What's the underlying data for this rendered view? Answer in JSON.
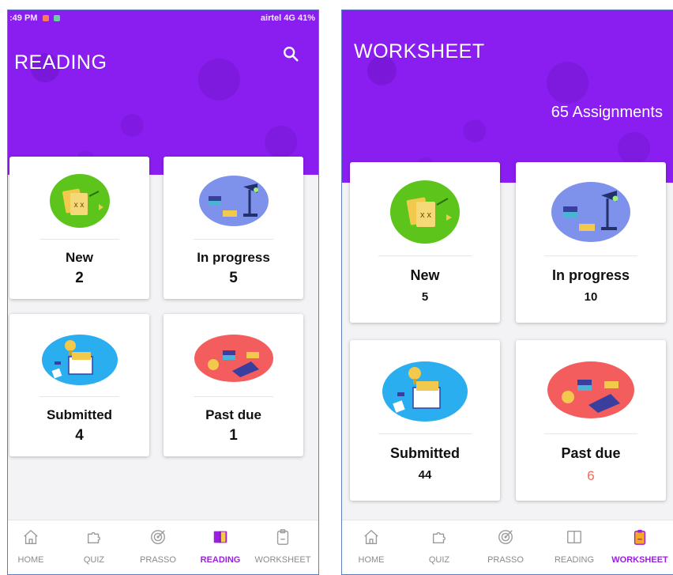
{
  "left_screen": {
    "statusbar": {
      "time": ":49 PM",
      "right": "airtel 4G  41%"
    },
    "title": "READING",
    "cards": [
      {
        "label": "New",
        "count": "2"
      },
      {
        "label": "In progress",
        "count": "5"
      },
      {
        "label": "Submitted",
        "count": "4"
      },
      {
        "label": "Past due",
        "count": "1"
      }
    ],
    "nav": [
      {
        "label": "HOME",
        "icon": "home-icon"
      },
      {
        "label": "QUIZ",
        "icon": "puzzle-icon"
      },
      {
        "label": "PRASSO",
        "icon": "target-icon"
      },
      {
        "label": "READING",
        "icon": "book-icon",
        "active": true
      },
      {
        "label": "WORKSHEET",
        "icon": "clipboard-icon"
      }
    ]
  },
  "right_screen": {
    "title": "WORKSHEET",
    "assignments": "65 Assignments",
    "cards": [
      {
        "label": "New",
        "count": "5"
      },
      {
        "label": "In progress",
        "count": "10"
      },
      {
        "label": "Submitted",
        "count": "44"
      },
      {
        "label": "Past due",
        "count": "6"
      }
    ],
    "nav": [
      {
        "label": "HOME",
        "icon": "home-icon"
      },
      {
        "label": "QUIZ",
        "icon": "puzzle-icon"
      },
      {
        "label": "PRASSO",
        "icon": "target-icon"
      },
      {
        "label": "READING",
        "icon": "book-icon"
      },
      {
        "label": "WORKSHEET",
        "icon": "clipboard-icon",
        "active": true
      }
    ]
  },
  "colors": {
    "header_purple": "#8a1ef0",
    "active_nav": "#9b1fe0",
    "new_blob": "#5cc41a",
    "in_progress_blob": "#7e92ec",
    "submitted_blob": "#2aaef0",
    "past_due_blob": "#f35d5d",
    "overdue_count": "#f36b5b"
  }
}
